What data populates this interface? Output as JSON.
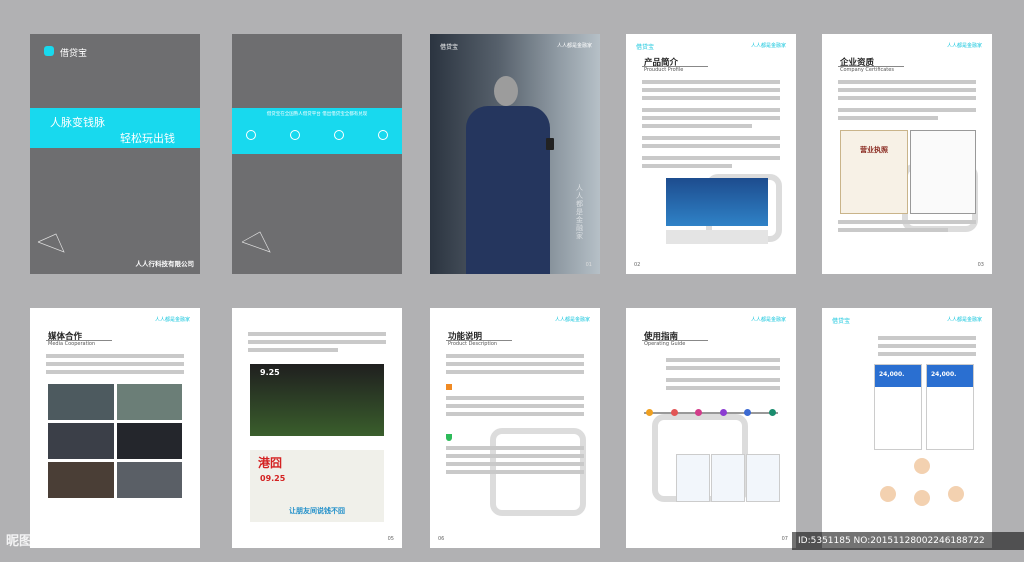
{
  "cover": {
    "logo": "借贷宝",
    "slogan1": "人脉变钱脉",
    "slogan2": "轻松玩出钱",
    "company": "人人行科技有限公司"
  },
  "back_cover": {
    "banner": "借贷宝在全国熟人借贷平台 借出借贷宝全都有兑现"
  },
  "photo_page": {
    "logo": "借贷宝",
    "header_right": "人人都是金融家",
    "vertical_text": "人人都是金融家",
    "page": "01"
  },
  "common": {
    "logo": "借贷宝",
    "header_right": "人人都是金融家"
  },
  "intro": {
    "title": "产品简介",
    "en": "Prouduct Profile",
    "page": "02"
  },
  "cert": {
    "title": "企业资质",
    "en": "Company Certificates",
    "license": "营业执照",
    "page": "03"
  },
  "media": {
    "title": "媒体合作",
    "en": "Media Cooperation"
  },
  "ads": {
    "poster1": "9.25",
    "poster2": "港囧",
    "poster2_date": "09.25",
    "banner": "让朋友间说钱不囧",
    "page": "05"
  },
  "func": {
    "title": "功能说明",
    "en": "Product Description",
    "page": "06"
  },
  "guide": {
    "title": "使用指南",
    "en": "Operating Guide",
    "page": "07"
  },
  "credit": {
    "amount1": "24,000.",
    "amount2": "24,000."
  },
  "watermark": {
    "site": "昵图网 www.nipic.com",
    "id": "ID:5351185 NO:20151128002246188722"
  }
}
